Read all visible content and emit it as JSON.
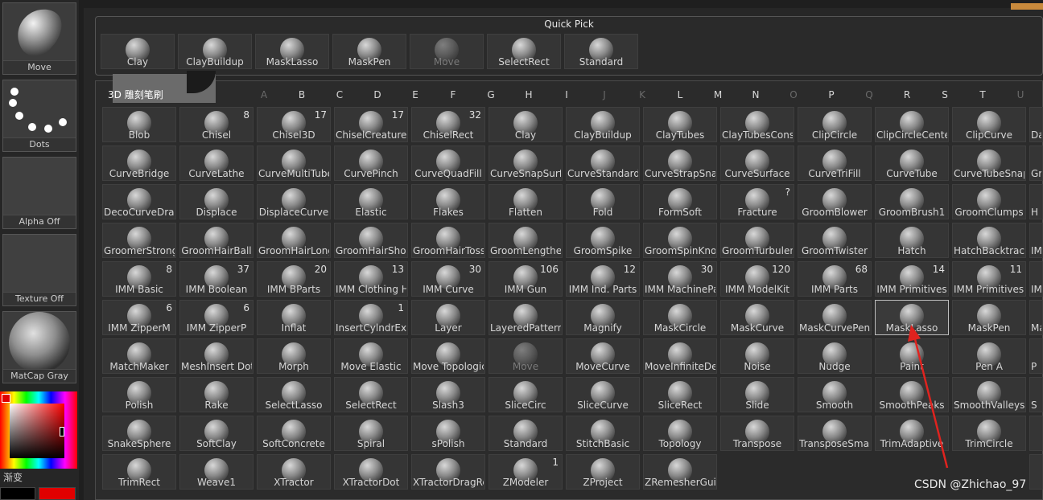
{
  "shelf": {
    "items": [
      {
        "label": "Move",
        "icon": "move-brush-icon"
      },
      {
        "label": "Dots",
        "icon": "dots-stroke-icon"
      },
      {
        "label": "Alpha Off",
        "icon": "alpha-icon"
      },
      {
        "label": "Texture Off",
        "icon": "texture-icon"
      },
      {
        "label": "MatCap Gray",
        "icon": "matcap-sphere-icon"
      }
    ],
    "gradient_label": "渐变",
    "main_color": "#e00000",
    "secondary_color": "#000000"
  },
  "quick_pick": {
    "title": "Quick Pick",
    "items": [
      {
        "label": "Clay"
      },
      {
        "label": "ClayBuildup"
      },
      {
        "label": "MaskLasso"
      },
      {
        "label": "MaskPen"
      },
      {
        "label": "Move",
        "dim": true
      },
      {
        "label": "SelectRect"
      },
      {
        "label": "Standard"
      }
    ]
  },
  "brush_panel": {
    "title": "3D 雕刻笔刷",
    "letters": [
      {
        "l": "A",
        "off": true
      },
      {
        "l": "B"
      },
      {
        "l": "C"
      },
      {
        "l": "D"
      },
      {
        "l": "E"
      },
      {
        "l": "F"
      },
      {
        "l": "G"
      },
      {
        "l": "H"
      },
      {
        "l": "I"
      },
      {
        "l": "J",
        "off": true
      },
      {
        "l": "K",
        "off": true
      },
      {
        "l": "L"
      },
      {
        "l": "M"
      },
      {
        "l": "N"
      },
      {
        "l": "O",
        "off": true
      },
      {
        "l": "P"
      },
      {
        "l": "Q",
        "off": true
      },
      {
        "l": "R"
      },
      {
        "l": "S"
      },
      {
        "l": "T"
      },
      {
        "l": "U",
        "off": true
      }
    ],
    "rows": [
      [
        {
          "label": "Blob"
        },
        {
          "label": "Chisel",
          "count": "8"
        },
        {
          "label": "Chisel3D",
          "count": "17"
        },
        {
          "label": "ChiselCreature",
          "count": "17"
        },
        {
          "label": "ChiselRect",
          "count": "32"
        },
        {
          "label": "Clay"
        },
        {
          "label": "ClayBuildup"
        },
        {
          "label": "ClayTubes"
        },
        {
          "label": "ClayTubesConst"
        },
        {
          "label": "ClipCircle"
        },
        {
          "label": "ClipCircleCenter"
        },
        {
          "label": "ClipCurve"
        }
      ],
      [
        {
          "label": "CurveBridge"
        },
        {
          "label": "CurveLathe"
        },
        {
          "label": "CurveMultiTube"
        },
        {
          "label": "CurvePinch"
        },
        {
          "label": "CurveQuadFill"
        },
        {
          "label": "CurveSnapSurfa"
        },
        {
          "label": "CurveStandard"
        },
        {
          "label": "CurveStrapSnap"
        },
        {
          "label": "CurveSurface"
        },
        {
          "label": "CurveTriFill"
        },
        {
          "label": "CurveTube"
        },
        {
          "label": "CurveTubeSnap"
        }
      ],
      [
        {
          "label": "DecoCurveDragD"
        },
        {
          "label": "Displace"
        },
        {
          "label": "DisplaceCurve"
        },
        {
          "label": "Elastic"
        },
        {
          "label": "Flakes"
        },
        {
          "label": "Flatten"
        },
        {
          "label": "Fold"
        },
        {
          "label": "FormSoft"
        },
        {
          "label": "Fracture",
          "count": "?"
        },
        {
          "label": "GroomBlower"
        },
        {
          "label": "GroomBrush1"
        },
        {
          "label": "GroomClumps"
        }
      ],
      [
        {
          "label": "GroomerStrong"
        },
        {
          "label": "GroomHairBall"
        },
        {
          "label": "GroomHairLong"
        },
        {
          "label": "GroomHairShort"
        },
        {
          "label": "GroomHairToss"
        },
        {
          "label": "GroomLengthen"
        },
        {
          "label": "GroomSpike"
        },
        {
          "label": "GroomSpinKnot"
        },
        {
          "label": "GroomTurbulenc"
        },
        {
          "label": "GroomTwister"
        },
        {
          "label": "Hatch"
        },
        {
          "label": "HatchBacktrack"
        }
      ],
      [
        {
          "label": "IMM Basic",
          "count": "8"
        },
        {
          "label": "IMM Boolean",
          "count": "37"
        },
        {
          "label": "IMM BParts",
          "count": "20"
        },
        {
          "label": "IMM Clothing Ha",
          "count": "13"
        },
        {
          "label": "IMM Curve",
          "count": "30"
        },
        {
          "label": "IMM Gun",
          "count": "106"
        },
        {
          "label": "IMM Ind. Parts",
          "count": "12"
        },
        {
          "label": "IMM MachinePar",
          "count": "30"
        },
        {
          "label": "IMM ModelKit",
          "count": "120"
        },
        {
          "label": "IMM Parts",
          "count": "68"
        },
        {
          "label": "IMM Primitives",
          "count": "14"
        },
        {
          "label": "IMM PrimitivesH",
          "count": "11"
        }
      ],
      [
        {
          "label": "IMM ZipperM",
          "count": "6"
        },
        {
          "label": "IMM ZipperP",
          "count": "6"
        },
        {
          "label": "Inflat"
        },
        {
          "label": "InsertCylndrExt",
          "count": "1"
        },
        {
          "label": "Layer"
        },
        {
          "label": "LayeredPattern"
        },
        {
          "label": "Magnify"
        },
        {
          "label": "MaskCircle"
        },
        {
          "label": "MaskCurve"
        },
        {
          "label": "MaskCurvePen"
        },
        {
          "label": "MaskLasso",
          "selected": true
        },
        {
          "label": "MaskPen"
        }
      ],
      [
        {
          "label": "MatchMaker"
        },
        {
          "label": "MeshInsert Dot"
        },
        {
          "label": "Morph"
        },
        {
          "label": "Move Elastic"
        },
        {
          "label": "Move Topologica"
        },
        {
          "label": "Move",
          "dim": true
        },
        {
          "label": "MoveCurve"
        },
        {
          "label": "MoveInfiniteDep"
        },
        {
          "label": "Noise"
        },
        {
          "label": "Nudge"
        },
        {
          "label": "Paint"
        },
        {
          "label": "Pen A"
        }
      ],
      [
        {
          "label": "Polish"
        },
        {
          "label": "Rake"
        },
        {
          "label": "SelectLasso"
        },
        {
          "label": "SelectRect"
        },
        {
          "label": "Slash3"
        },
        {
          "label": "SliceCirc"
        },
        {
          "label": "SliceCurve"
        },
        {
          "label": "SliceRect"
        },
        {
          "label": "Slide"
        },
        {
          "label": "Smooth"
        },
        {
          "label": "SmoothPeaks"
        },
        {
          "label": "SmoothValleys"
        }
      ],
      [
        {
          "label": "SnakeSphere"
        },
        {
          "label": "SoftClay"
        },
        {
          "label": "SoftConcrete"
        },
        {
          "label": "Spiral"
        },
        {
          "label": "sPolish"
        },
        {
          "label": "Standard"
        },
        {
          "label": "StitchBasic"
        },
        {
          "label": "Topology"
        },
        {
          "label": "Transpose"
        },
        {
          "label": "TransposeSmart"
        },
        {
          "label": "TrimAdaptive"
        },
        {
          "label": "TrimCircle"
        }
      ],
      [
        {
          "label": "TrimRect"
        },
        {
          "label": "Weave1"
        },
        {
          "label": "XTractor"
        },
        {
          "label": "XTractorDot"
        },
        {
          "label": "XTractorDragRe"
        },
        {
          "label": "ZModeler",
          "count": "1"
        },
        {
          "label": "ZProject"
        },
        {
          "label": "ZRemesherGuide"
        }
      ]
    ],
    "edge_labels": [
      "Da",
      "Gr",
      "H",
      "IM",
      "IM",
      "Ma",
      "P",
      "S",
      "",
      ""
    ]
  },
  "watermark": "CSDN @Zhichao_97",
  "colors": {
    "accent": "#c98a3c",
    "arrow": "#e0231f",
    "selected_border": "#bdbdbd"
  }
}
